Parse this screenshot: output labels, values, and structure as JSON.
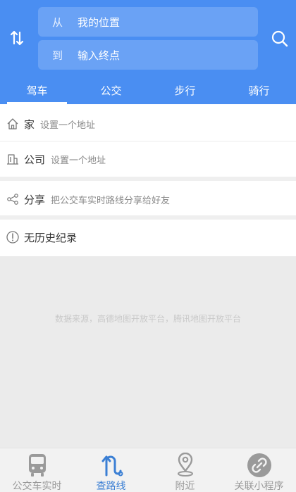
{
  "header": {
    "from_prefix": "从",
    "from_value": "我的位置",
    "to_prefix": "到",
    "to_value": "输入终点",
    "swap_icon": "swap-vertical-icon",
    "search_icon": "search-icon",
    "bg_color": "#4a8ef2"
  },
  "tabs": [
    {
      "label": "驾车",
      "active": true
    },
    {
      "label": "公交",
      "active": false
    },
    {
      "label": "步行",
      "active": false
    },
    {
      "label": "骑行",
      "active": false
    }
  ],
  "shortcuts": {
    "home": {
      "title": "家",
      "subtitle": "设置一个地址",
      "icon": "home-icon"
    },
    "company": {
      "title": "公司",
      "subtitle": "设置一个地址",
      "icon": "building-icon"
    },
    "share": {
      "title": "分享",
      "subtitle": "把公交车实时路线分享给好友",
      "icon": "share-icon"
    }
  },
  "history": {
    "text": "无历史纪录",
    "icon": "info-circle-icon"
  },
  "source_note": "数据来源，高德地图开放平台，腾讯地图开放平台",
  "bottom_nav": [
    {
      "label": "公交车实时",
      "icon": "bus-icon",
      "active": false
    },
    {
      "label": "查路线",
      "icon": "route-icon",
      "active": true
    },
    {
      "label": "附近",
      "icon": "location-pin-icon",
      "active": false
    },
    {
      "label": "关联小程序",
      "icon": "link-icon",
      "active": false
    }
  ],
  "colors": {
    "accent": "#4a8ef2",
    "nav_active": "#3b7fd4",
    "nav_inactive": "#999999"
  }
}
